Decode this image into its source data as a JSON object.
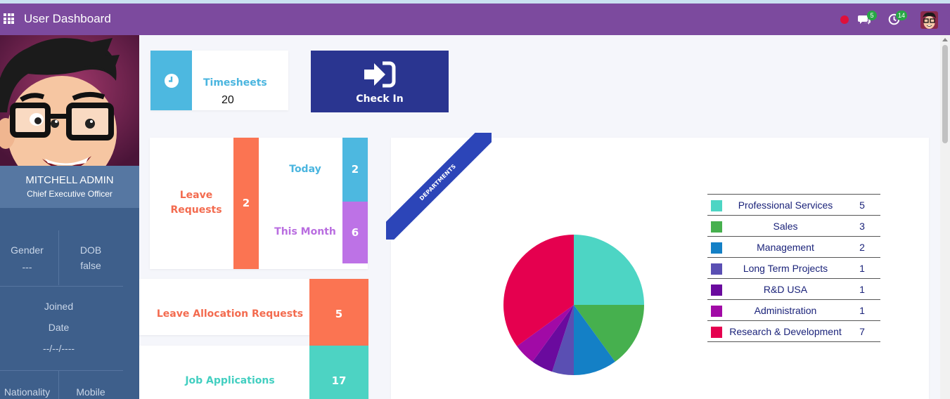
{
  "navbar": {
    "title": "User Dashboard",
    "messages_badge": "5",
    "activities_badge": "14",
    "icons": [
      "apps-grid-icon",
      "recording-dot-icon",
      "chat-icon",
      "clock-icon",
      "user-avatar"
    ]
  },
  "profile": {
    "name": "MITCHELL ADMIN",
    "job_title": "Chief Executive Officer",
    "fields": {
      "gender_label": "Gender",
      "gender_value": "---",
      "dob_label": "DOB",
      "dob_value": "false",
      "joined_label": "Joined",
      "date_label": "Date",
      "joined_value": "--/--/----",
      "nationality_label": "Nationality",
      "mobile_label": "Mobile"
    }
  },
  "timesheets": {
    "label": "Timesheets",
    "value": "20"
  },
  "checkin": {
    "label": "Check In"
  },
  "leave_requests": {
    "label": "Leave Requests",
    "value": "2",
    "today_label": "Today",
    "today_value": "2",
    "month_label": "This Month",
    "month_value": "6"
  },
  "leave_allocation": {
    "label": "Leave Allocation Requests",
    "value": "5"
  },
  "job_applications": {
    "label": "Job Applications",
    "value": "17"
  },
  "departments": {
    "ribbon_label": "DEPARTMENTS"
  },
  "chart_data": {
    "type": "pie",
    "title": "",
    "slices": [
      {
        "label": "Professional Services",
        "value": 5,
        "color": "#4dd5c4"
      },
      {
        "label": "Sales",
        "value": 3,
        "color": "#46b04e"
      },
      {
        "label": "Management",
        "value": 2,
        "color": "#1480c6"
      },
      {
        "label": "Long Term Projects",
        "value": 1,
        "color": "#5a4fb3"
      },
      {
        "label": "R&D USA",
        "value": 1,
        "color": "#6a0a9e"
      },
      {
        "label": "Administration",
        "value": 1,
        "color": "#a10aa6"
      },
      {
        "label": "Research & Development",
        "value": 7,
        "color": "#e5004f"
      }
    ],
    "legend_position": "right"
  },
  "colors": {
    "navbar": "#7c4a9e",
    "sidebar": "#3e5f8b",
    "accent_blue": "#4db8e0",
    "accent_orange": "#fb7452",
    "accent_purple": "#bd72e6",
    "accent_teal": "#4dd3c3",
    "checkin": "#2a3590"
  }
}
